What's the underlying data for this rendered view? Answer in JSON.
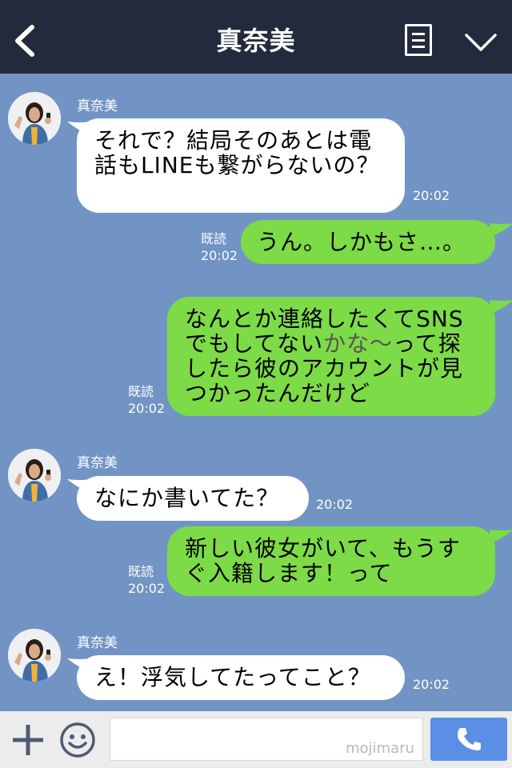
{
  "header": {
    "title": "真奈美",
    "back_icon": "chevron-left-icon",
    "menu_icon": "notes-icon",
    "collapse_icon": "chevron-down-icon"
  },
  "messages": [
    {
      "direction": "in",
      "sender": "真奈美",
      "text": "それで？結局そのあとは電話もLINEも繋がらないの？",
      "time": "20:02"
    },
    {
      "direction": "out",
      "read": "既読",
      "text": "うん。しかもさ…。",
      "time": "20:02"
    },
    {
      "direction": "out",
      "read": "既読",
      "text_before": "なんとか連絡したくてSNSでもしてない",
      "text_highlight": "かな〜",
      "text_after": "って探したら彼のアカウントが見つかったんだけど",
      "time": "20:02"
    },
    {
      "direction": "in",
      "sender": "真奈美",
      "text": "なにか書いてた？",
      "time": "20:02"
    },
    {
      "direction": "out",
      "read": "既読",
      "text": "新しい彼女がいて、もうすぐ入籍します！って",
      "time": "20:02"
    },
    {
      "direction": "in",
      "sender": "真奈美",
      "text": "え！浮気してたってこと？",
      "time": "20:02"
    }
  ],
  "footer": {
    "plus_icon": "plus-icon",
    "emoji_icon": "smiley-icon",
    "input_value": "",
    "watermark": "mojimaru",
    "call_icon": "phone-icon"
  },
  "colors": {
    "background": "#7194c4",
    "header": "#232a3e",
    "outgoing_bubble": "#7ddb47",
    "incoming_bubble": "#ffffff",
    "call_button": "#5b8fe6"
  }
}
